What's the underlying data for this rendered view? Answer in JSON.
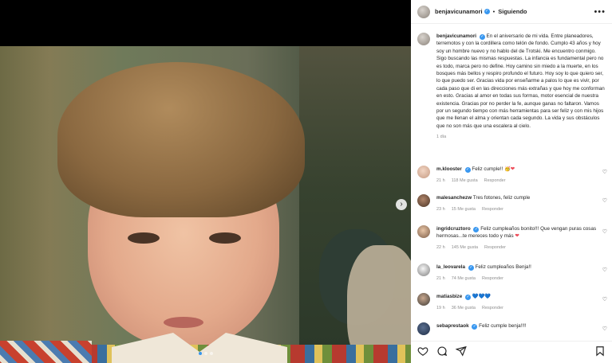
{
  "post": {
    "username": "benjavicunamori",
    "follow_label": "Siguiendo",
    "more_label": "•••",
    "caption": "En el aniversario de mi vida. Entre planeadores, terremotos y con la cordillera como telón de fondo. Cumplo 43 años y hoy soy un hombre nuevo y no hablo del de Trotski. Me encuentro conmigo. Sigo buscando las mismas respuestas. La infancia es fundamental pero no es todo, marca pero no define. Hoy camino sin miedo a la muerte, en los bosques más bellos y respiro profundo el futuro. Hoy soy lo que quiero ser, lo que puedo ser. Gracias vida por enseñarme a palos lo que es vivir, por cada paso que di en las direcciones más extrañas y que hoy me conforman en esto. Gracias al amor en todas sus formas, motor esencial de nuestra existencia. Gracias por no perder la fe, aunque ganas no faltaron. Vamos por un segundo tiempo con más herramientas para ser feliz y con mis hijos que me llenan el alma y orientan cada segundo. La vida y sus obstáculos que no son más que una escalera al cielo.",
    "time": "1 día"
  },
  "media": {
    "next_label": "›",
    "slide_count": 3
  },
  "comments": [
    {
      "username": "m.klooster",
      "verified": true,
      "text": "Feliz cumple!! 🥳❤️",
      "time": "21 h",
      "likes": "118 Me gusta",
      "reply": "Responder"
    },
    {
      "username": "malesanchezw",
      "verified": false,
      "text": "Tres fotones, feliz cumple",
      "time": "23 h",
      "likes": "15 Me gusta",
      "reply": "Responder"
    },
    {
      "username": "ingridcruztoro",
      "verified": true,
      "text": "Feliz cumpleaños bonito!!! Que vengan puras cosas hermosas...te mereces todo y más ❤️",
      "time": "22 h",
      "likes": "145 Me gusta",
      "reply": "Responder"
    },
    {
      "username": "la_leovarela",
      "verified": true,
      "text": "Feliz cumpleaños Benja!!",
      "time": "21 h",
      "likes": "74 Me gusta",
      "reply": "Responder"
    },
    {
      "username": "matiasbize",
      "verified": true,
      "text": "💙💙💙",
      "time": "19 h",
      "likes": "36 Me gusta",
      "reply": "Responder"
    },
    {
      "username": "sebaprestaok",
      "verified": true,
      "text": "Feliz cumple benja!!!!",
      "time": "",
      "likes": "",
      "reply": ""
    }
  ],
  "icons": {
    "like": "heart-outline-icon",
    "comment": "comment-bubble-icon",
    "share": "paper-plane-icon",
    "save": "bookmark-icon"
  },
  "colors": {
    "verified": "#3897f0",
    "heart_red": "#ed4956",
    "meta_gray": "#8e8e8e",
    "carousel_active": "#3797f0"
  }
}
